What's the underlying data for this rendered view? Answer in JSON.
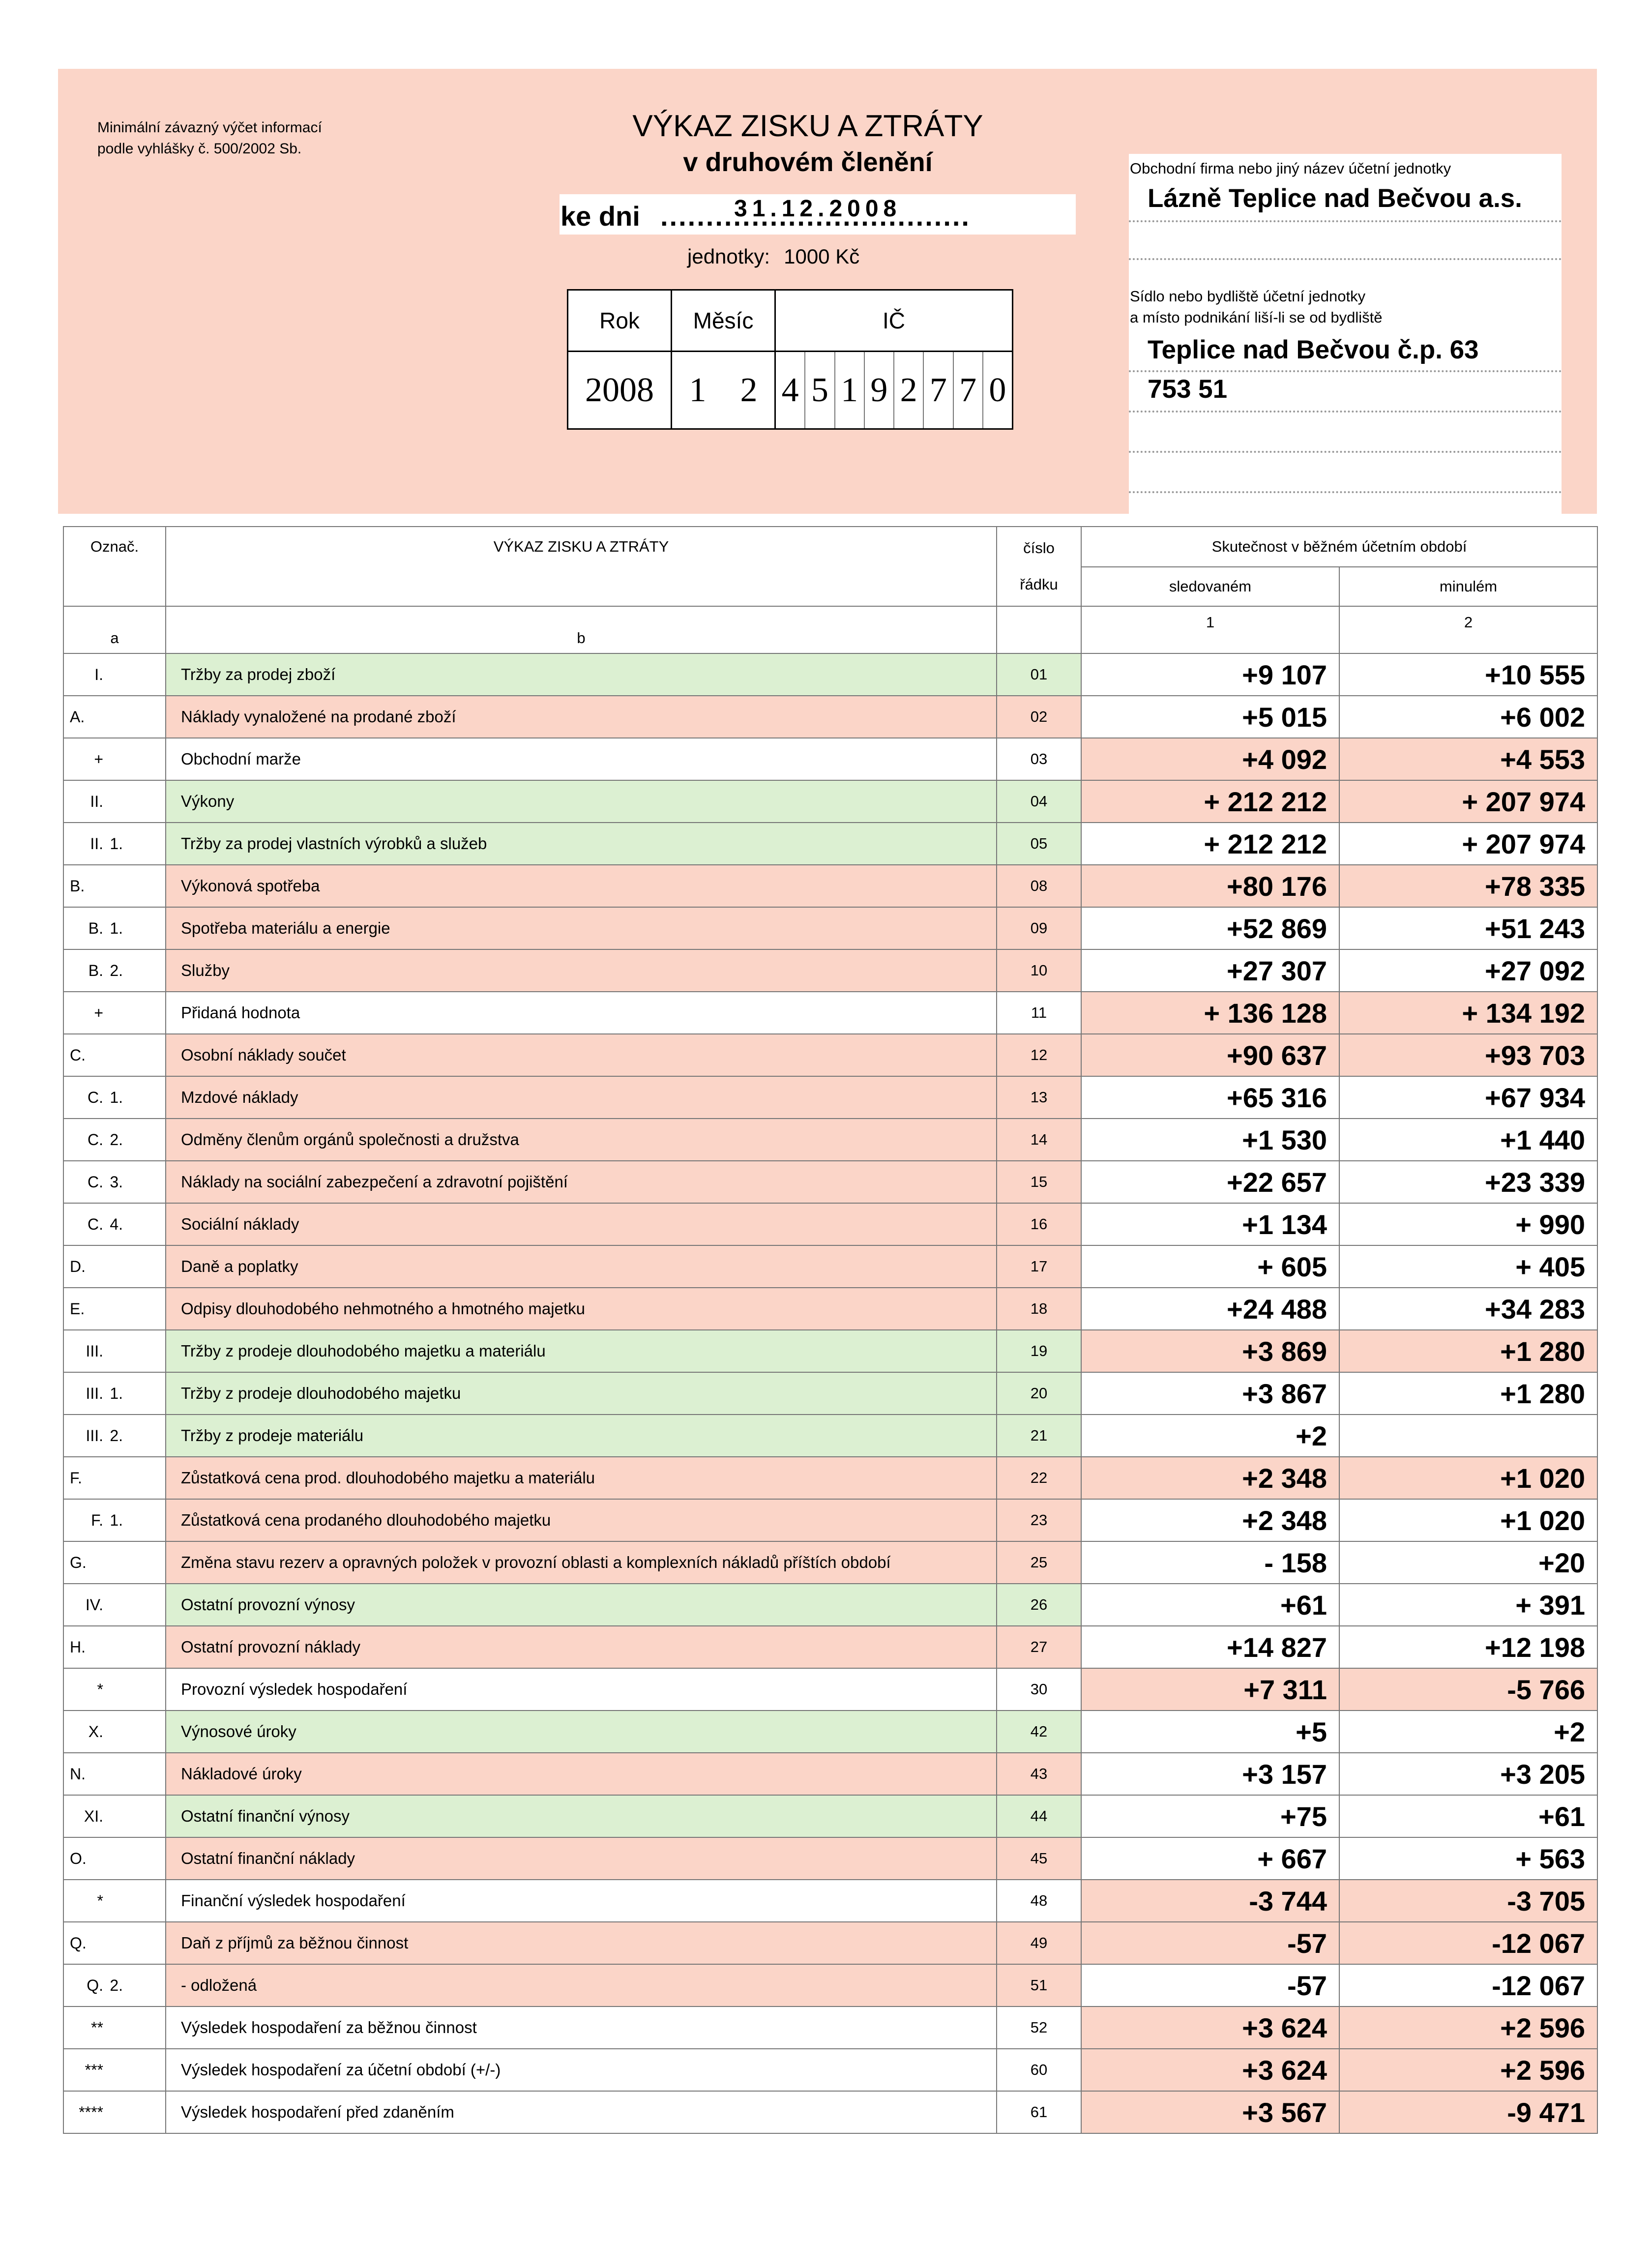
{
  "header": {
    "min_info_1": "Minimální závazný výčet informací",
    "min_info_2": "podle vyhlášky č. 500/2002 Sb.",
    "title_1": "VÝKAZ ZISKU A ZTRÁTY",
    "title_2": "v druhovém členění",
    "ke_dni_label": "ke dni",
    "ke_dni_dots": "..................................",
    "date": "31.12.2008",
    "units_label": "jednotky:",
    "units_value": "1000 Kč",
    "rok_label": "Rok",
    "mesic_label": "Měsíc",
    "ic_label": "IČ",
    "rok": "2008",
    "mesic_1": "1",
    "mesic_2": "2",
    "ic_digits": [
      "4",
      "5",
      "1",
      "9",
      "2",
      "7",
      "7",
      "0"
    ]
  },
  "firm": {
    "name_label": "Obchodní firma nebo jiný název účetní jednotky",
    "name": "Lázně Teplice nad Bečvou a.s.",
    "seat_label_1": "Sídlo nebo bydliště účetní jednotky",
    "seat_label_2": "a místo podnikání liší-li se od bydliště",
    "address_1": "Teplice nad Bečvou č.p. 63",
    "address_2": "753 51"
  },
  "table": {
    "col_oznac": "Označ.",
    "col_title": "VÝKAZ ZISKU A ZTRÁTY",
    "col_cislo_1": "číslo",
    "col_cislo_2": "řádku",
    "col_skutecnost": "Skutečnost v běžném účetním období",
    "col_sledovanem": "sledovaném",
    "col_minulem": "minulém",
    "sub_a": "a",
    "sub_b": "b",
    "sub_1": "1",
    "sub_2": "2",
    "colors": {
      "green": "#dcf0d2",
      "pink": "#fbd5c8",
      "white": "#ffffff"
    },
    "rows": [
      {
        "l1": "I.",
        "l2": "",
        "label": "Tržby za prodej zboží",
        "num": "01",
        "v1": "+9 107",
        "v2": "+10 555",
        "lc": "g",
        "c1": "w",
        "c2": "w"
      },
      {
        "l1": "",
        "l0": "A.",
        "l2": "",
        "label": "Náklady vynaložené na prodané zboží",
        "num": "02",
        "v1": "+5 015",
        "v2": "+6 002",
        "lc": "p",
        "c1": "w",
        "c2": "w"
      },
      {
        "l1": "+",
        "l2": "",
        "label": "Obchodní marže",
        "num": "03",
        "v1": "+4 092",
        "v2": "+4 553",
        "lc": "w",
        "c1": "p",
        "c2": "p"
      },
      {
        "l1": "II.",
        "l2": "",
        "label": "Výkony",
        "num": "04",
        "v1": "+ 212 212",
        "v2": "+ 207 974",
        "lc": "g",
        "c1": "p",
        "c2": "p"
      },
      {
        "l1": "II.",
        "l2": "1.",
        "label": "Tržby za prodej vlastních výrobků a služeb",
        "num": "05",
        "v1": "+ 212 212",
        "v2": "+ 207 974",
        "lc": "g",
        "c1": "w",
        "c2": "w"
      },
      {
        "l1": "",
        "l0": "B.",
        "l2": "",
        "label": "Výkonová spotřeba",
        "num": "08",
        "v1": "+80 176",
        "v2": "+78 335",
        "lc": "p",
        "c1": "p",
        "c2": "p"
      },
      {
        "l1": "B.",
        "l2": "1.",
        "label": "Spotřeba materiálu a energie",
        "num": "09",
        "v1": "+52 869",
        "v2": "+51 243",
        "lc": "p",
        "c1": "w",
        "c2": "w"
      },
      {
        "l1": "B.",
        "l2": "2.",
        "label": "Služby",
        "num": "10",
        "v1": "+27 307",
        "v2": "+27 092",
        "lc": "p",
        "c1": "w",
        "c2": "w"
      },
      {
        "l1": "+",
        "l2": "",
        "label": "Přidaná hodnota",
        "num": "11",
        "v1": "+ 136 128",
        "v2": "+ 134 192",
        "lc": "w",
        "c1": "p",
        "c2": "p"
      },
      {
        "l1": "",
        "l0": "C.",
        "l2": "",
        "label": "Osobní náklady součet",
        "num": "12",
        "v1": "+90 637",
        "v2": "+93 703",
        "lc": "p",
        "c1": "p",
        "c2": "p"
      },
      {
        "l1": "C.",
        "l2": "1.",
        "label": "Mzdové náklady",
        "num": "13",
        "v1": "+65 316",
        "v2": "+67 934",
        "lc": "p",
        "c1": "w",
        "c2": "w"
      },
      {
        "l1": "C.",
        "l2": "2.",
        "label": "Odměny členům orgánů společnosti a družstva",
        "num": "14",
        "v1": "+1 530",
        "v2": "+1 440",
        "lc": "p",
        "c1": "w",
        "c2": "w"
      },
      {
        "l1": "C.",
        "l2": "3.",
        "label": "Náklady na sociální zabezpečení a zdravotní pojištění",
        "num": "15",
        "v1": "+22 657",
        "v2": "+23 339",
        "lc": "p",
        "c1": "w",
        "c2": "w"
      },
      {
        "l1": "C.",
        "l2": "4.",
        "label": "Sociální náklady",
        "num": "16",
        "v1": "+1 134",
        "v2": "+ 990",
        "lc": "p",
        "c1": "w",
        "c2": "w"
      },
      {
        "l1": "",
        "l0": "D.",
        "l2": "",
        "label": "Daně a poplatky",
        "num": "17",
        "v1": "+ 605",
        "v2": "+ 405",
        "lc": "p",
        "c1": "w",
        "c2": "w"
      },
      {
        "l1": "",
        "l0": "E.",
        "l2": "",
        "label": "Odpisy dlouhodobého nehmotného a hmotného majetku",
        "num": "18",
        "v1": "+24 488",
        "v2": "+34 283",
        "lc": "p",
        "c1": "w",
        "c2": "w"
      },
      {
        "l1": "III.",
        "l2": "",
        "label": "Tržby z prodeje dlouhodobého majetku a materiálu",
        "num": "19",
        "v1": "+3 869",
        "v2": "+1 280",
        "lc": "g",
        "c1": "p",
        "c2": "p"
      },
      {
        "l1": "III.",
        "l2": "1.",
        "label": "Tržby z prodeje dlouhodobého majetku",
        "num": "20",
        "v1": "+3 867",
        "v2": "+1 280",
        "lc": "g",
        "c1": "w",
        "c2": "w"
      },
      {
        "l1": "III.",
        "l2": "2.",
        "label": "Tržby z prodeje materiálu",
        "num": "21",
        "v1": "+2",
        "v2": "",
        "lc": "g",
        "c1": "w",
        "c2": "w"
      },
      {
        "l1": "",
        "l0": "F.",
        "l2": "",
        "label": "Zůstatková cena prod. dlouhodobého majetku a materiálu",
        "num": "22",
        "v1": "+2 348",
        "v2": "+1 020",
        "lc": "p",
        "c1": "p",
        "c2": "p"
      },
      {
        "l1": "F.",
        "l2": "1.",
        "label": "Zůstatková cena prodaného dlouhodobého majetku",
        "num": "23",
        "v1": "+2 348",
        "v2": "+1 020",
        "lc": "p",
        "c1": "w",
        "c2": "w"
      },
      {
        "l1": "",
        "l0": "G.",
        "l2": "",
        "label": "Změna stavu rezerv a opravných položek v provozní oblasti a komplexních nákladů příštích období",
        "num": "25",
        "v1": "- 158",
        "v2": "+20",
        "lc": "p",
        "c1": "w",
        "c2": "w"
      },
      {
        "l1": "IV.",
        "l2": "",
        "label": "Ostatní provozní výnosy",
        "num": "26",
        "v1": "+61",
        "v2": "+ 391",
        "lc": "g",
        "c1": "w",
        "c2": "w"
      },
      {
        "l1": "",
        "l0": "H.",
        "l2": "",
        "label": "Ostatní provozní náklady",
        "num": "27",
        "v1": "+14 827",
        "v2": "+12 198",
        "lc": "p",
        "c1": "w",
        "c2": "w"
      },
      {
        "l1": "*",
        "l2": "",
        "label": "Provozní výsledek hospodaření",
        "num": "30",
        "v1": "+7 311",
        "v2": "-5 766",
        "lc": "w",
        "c1": "p",
        "c2": "p"
      },
      {
        "l1": "X.",
        "l2": "",
        "label": "Výnosové úroky",
        "num": "42",
        "v1": "+5",
        "v2": "+2",
        "lc": "g",
        "c1": "w",
        "c2": "w"
      },
      {
        "l1": "",
        "l0": "N.",
        "l2": "",
        "label": "Nákladové úroky",
        "num": "43",
        "v1": "+3 157",
        "v2": "+3 205",
        "lc": "p",
        "c1": "w",
        "c2": "w"
      },
      {
        "l1": "XI.",
        "l2": "",
        "label": "Ostatní finanční výnosy",
        "num": "44",
        "v1": "+75",
        "v2": "+61",
        "lc": "g",
        "c1": "w",
        "c2": "w"
      },
      {
        "l1": "",
        "l0": "O.",
        "l2": "",
        "label": "Ostatní finanční náklady",
        "num": "45",
        "v1": "+ 667",
        "v2": "+ 563",
        "lc": "p",
        "c1": "w",
        "c2": "w"
      },
      {
        "l1": "*",
        "l2": "",
        "label": "Finanční výsledek hospodaření",
        "num": "48",
        "v1": "-3 744",
        "v2": "-3 705",
        "lc": "w",
        "c1": "p",
        "c2": "p"
      },
      {
        "l1": "",
        "l0": "Q.",
        "l2": "",
        "label": "Daň z příjmů za běžnou činnost",
        "num": "49",
        "v1": "-57",
        "v2": "-12 067",
        "lc": "p",
        "c1": "p",
        "c2": "p"
      },
      {
        "l1": "Q.",
        "l2": "2.",
        "label": "- odložená",
        "num": "51",
        "v1": "-57",
        "v2": "-12 067",
        "lc": "p",
        "c1": "w",
        "c2": "w"
      },
      {
        "l1": "**",
        "l2": "",
        "label": "Výsledek hospodaření za běžnou činnost",
        "num": "52",
        "v1": "+3 624",
        "v2": "+2 596",
        "lc": "w",
        "c1": "p",
        "c2": "p"
      },
      {
        "l1": "***",
        "l2": "",
        "label": "Výsledek hospodaření za účetní období (+/-)",
        "num": "60",
        "v1": "+3 624",
        "v2": "+2 596",
        "lc": "w",
        "c1": "p",
        "c2": "p"
      },
      {
        "l1": "****",
        "l2": "",
        "label": "Výsledek hospodaření před zdaněním",
        "num": "61",
        "v1": "+3 567",
        "v2": "-9 471",
        "lc": "w",
        "c1": "p",
        "c2": "p"
      }
    ]
  }
}
